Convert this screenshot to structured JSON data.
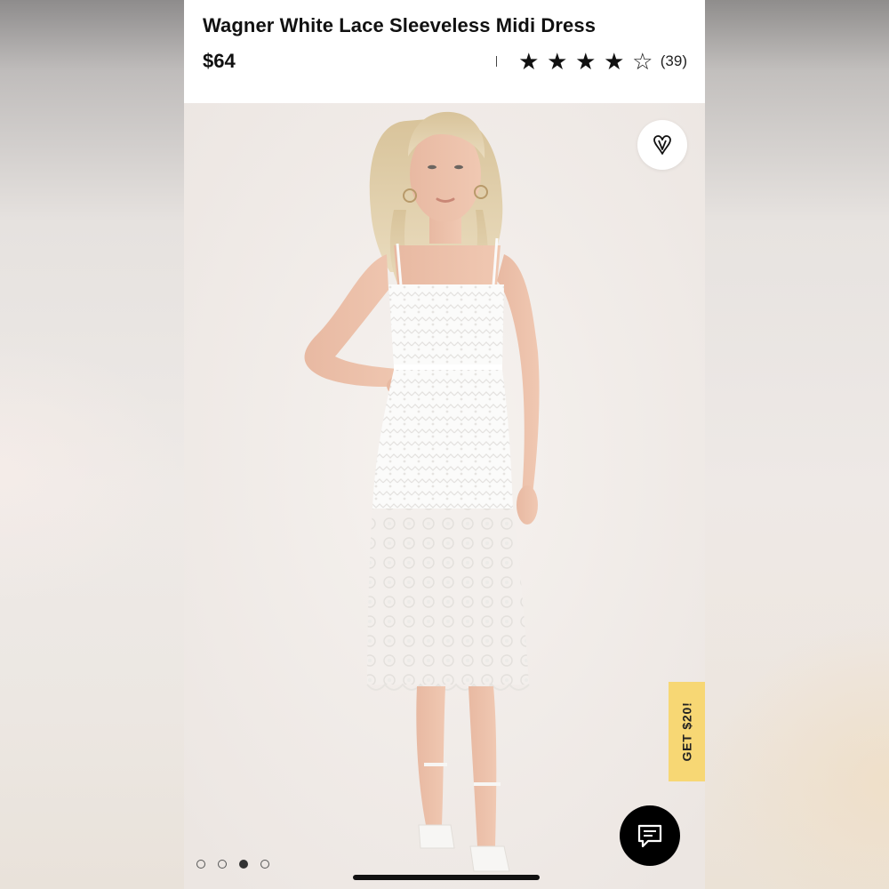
{
  "product": {
    "title": "Wagner White Lace Sleeveless Midi Dress",
    "price": "$64",
    "rating": {
      "value": 4,
      "max": 5,
      "count_label": "(39)"
    }
  },
  "icons": {
    "favorite": "heart-v-icon",
    "chat": "chat-bubble-icon",
    "star_filled": "★",
    "star_empty": "☆"
  },
  "promo": {
    "label": "GET $20!"
  },
  "carousel": {
    "total": 4,
    "active_index": 2
  },
  "colors": {
    "accent_yellow": "#f7d774",
    "text": "#111111",
    "chat_bg": "#000000"
  }
}
